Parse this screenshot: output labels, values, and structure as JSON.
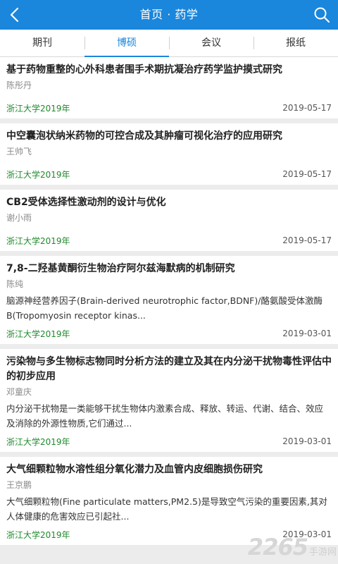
{
  "header": {
    "title": "首页 · 药学",
    "back_icon": "chevron-left-icon",
    "search_icon": "search-icon",
    "bg_color": "#1a86dc"
  },
  "tabs": [
    {
      "label": "期刊",
      "active": false
    },
    {
      "label": "博硕",
      "active": true
    },
    {
      "label": "会议",
      "active": false
    },
    {
      "label": "报纸",
      "active": false
    }
  ],
  "items": [
    {
      "title": "基于药物重整的心外科患者围手术期抗凝治疗药学监护摸式研究",
      "author": "陈彤丹",
      "abstract": "",
      "source": "浙江大学2019年",
      "date": "2019-05-17"
    },
    {
      "title": "中空囊泡状纳米药物的可控合成及其肿瘤可视化治疗的应用研究",
      "author": "王帅飞",
      "abstract": "",
      "source": "浙江大学2019年",
      "date": "2019-05-17"
    },
    {
      "title": "CB2受体选择性激动剂的设计与优化",
      "author": "谢小雨",
      "abstract": "",
      "source": "浙江大学2019年",
      "date": "2019-05-17"
    },
    {
      "title": "7,8-二羟基黄酮衍生物治疗阿尔兹海默病的机制研究",
      "author": "陈纯",
      "abstract": "脑源神经营养因子(Brain-derived neurotrophic factor,BDNF)/酪氨酸受体激酶B(Tropomyosin receptor kinas...",
      "source": "浙江大学2019年",
      "date": "2019-03-01"
    },
    {
      "title": "污染物与多生物标志物同时分析方法的建立及其在内分泌干扰物毒性评估中的初步应用",
      "author": "邓童庆",
      "abstract": "内分泌干扰物是一类能够干扰生物体内激素合成、释放、转运、代谢、结合、效应及消除的外源性物质,它们通过...",
      "source": "浙江大学2019年",
      "date": "2019-03-01"
    },
    {
      "title": "大气细颗粒物水溶性组分氧化潜力及血管内皮细胞损伤研究",
      "author": "王京鹏",
      "abstract": "大气细颗粒物(Fine particulate matters,PM2.5)是导致空气污染的重要因素,其对人体健康的危害效应已引起社...",
      "source": "浙江大学2019年",
      "date": "2019-03-01"
    }
  ],
  "watermark": {
    "number": "2265",
    "text": "手游网"
  }
}
